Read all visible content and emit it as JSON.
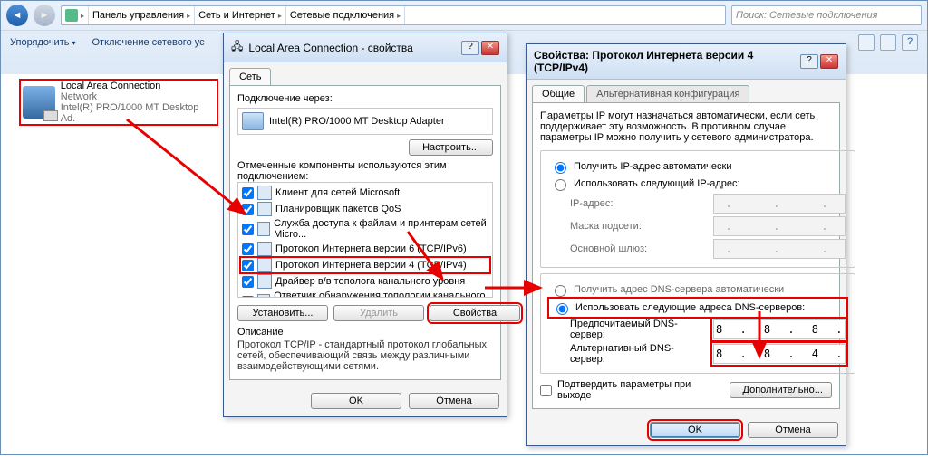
{
  "explorer": {
    "breadcrumb": [
      "Панель управления",
      "Сеть и Интернет",
      "Сетевые подключения"
    ],
    "search_placeholder": "Поиск: Сетевые подключения",
    "toolbar": {
      "organize": "Упорядочить",
      "disable": "Отключение сетевого ус"
    }
  },
  "connection": {
    "name": "Local Area Connection",
    "type": "Network",
    "adapter": "Intel(R) PRO/1000 MT Desktop Ad."
  },
  "dlg1": {
    "title": "Local Area Connection - свойства",
    "tab_net": "Сеть",
    "connect_via": "Подключение через:",
    "adapter": "Intel(R) PRO/1000 MT Desktop Adapter",
    "configure": "Настроить...",
    "components_label": "Отмеченные компоненты используются этим подключением:",
    "items": [
      "Клиент для сетей Microsoft",
      "Планировщик пакетов QoS",
      "Служба доступа к файлам и принтерам сетей Micro...",
      "Протокол Интернета версии 6 (TCP/IPv6)",
      "Протокол Интернета версии 4 (TCP/IPv4)",
      "Драйвер в/в тополога канального уровня",
      "Ответчик обнаружения топологии канального уровня"
    ],
    "install": "Установить...",
    "uninstall": "Удалить",
    "properties": "Свойства",
    "desc_title": "Описание",
    "desc_body": "Протокол TCP/IP - стандартный протокол глобальных сетей, обеспечивающий связь между различными взаимодействующими сетями.",
    "ok": "OK",
    "cancel": "Отмена"
  },
  "dlg2": {
    "title": "Свойства: Протокол Интернета версии 4 (TCP/IPv4)",
    "tab_general": "Общие",
    "tab_alt": "Альтернативная конфигурация",
    "intro": "Параметры IP могут назначаться автоматически, если сеть поддерживает эту возможность. В противном случае параметры IP можно получить у сетевого администратора.",
    "ip_auto": "Получить IP-адрес автоматически",
    "ip_manual": "Использовать следующий IP-адрес:",
    "ip_label": "IP-адрес:",
    "mask_label": "Маска подсети:",
    "gw_label": "Основной шлюз:",
    "dns_auto": "Получить адрес DNS-сервера автоматически",
    "dns_manual": "Использовать следующие адреса DNS-серверов:",
    "dns_pref_label": "Предпочитаемый DNS-сервер:",
    "dns_alt_label": "Альтернативный DNS-сервер:",
    "dns_pref_value": "8 . 8 . 8 . 8",
    "dns_alt_value": "8 . 8 . 4 . 4",
    "validate": "Подтвердить параметры при выходе",
    "advanced": "Дополнительно...",
    "ok": "OK",
    "cancel": "Отмена",
    "ip_placeholder": ".   .   ."
  }
}
